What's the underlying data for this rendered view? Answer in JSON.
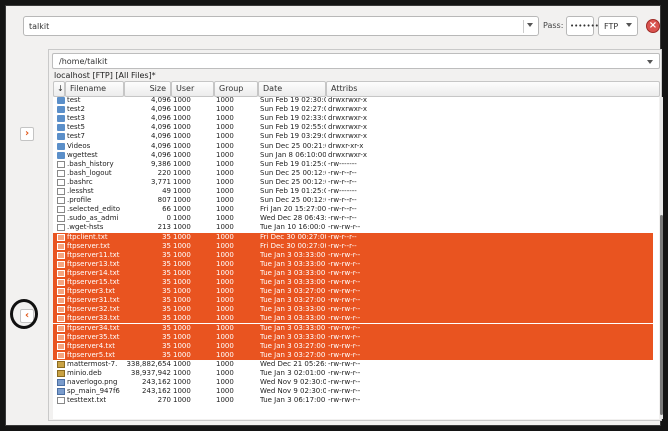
{
  "toolbar": {
    "host_value": "talkit",
    "pass_label": "Pass:",
    "pass_value": "••••••••",
    "protocol_value": "FTP"
  },
  "panel": {
    "path_value": "/home/talkit",
    "location_label": "localhost [FTP] [All Files]*"
  },
  "columns": [
    "Filename",
    "Size",
    "User",
    "Group",
    "Date",
    "Attribs"
  ],
  "files": [
    {
      "name": "test",
      "size": "4,096",
      "user": "1000",
      "group": "1000",
      "date": "Sun Feb 19 02:30:0",
      "attr": "drwxrwxr-x",
      "icon": "folder",
      "sel": false
    },
    {
      "name": "test2",
      "size": "4,096",
      "user": "1000",
      "group": "1000",
      "date": "Sun Feb 19 02:27:0",
      "attr": "drwxrwxr-x",
      "icon": "folder",
      "sel": false
    },
    {
      "name": "test3",
      "size": "4,096",
      "user": "1000",
      "group": "1000",
      "date": "Sun Feb 19 02:33:0",
      "attr": "drwxrwxr-x",
      "icon": "folder",
      "sel": false
    },
    {
      "name": "test5",
      "size": "4,096",
      "user": "1000",
      "group": "1000",
      "date": "Sun Feb 19 02:55:0",
      "attr": "drwxrwxr-x",
      "icon": "folder",
      "sel": false
    },
    {
      "name": "test7",
      "size": "4,096",
      "user": "1000",
      "group": "1000",
      "date": "Sun Feb 19 03:29:0",
      "attr": "drwxrwxr-x",
      "icon": "folder",
      "sel": false
    },
    {
      "name": "Videos",
      "size": "4,096",
      "user": "1000",
      "group": "1000",
      "date": "Sun Dec 25 00:21:0",
      "attr": "drwxr-xr-x",
      "icon": "folder",
      "sel": false
    },
    {
      "name": "wgettest",
      "size": "4,096",
      "user": "1000",
      "group": "1000",
      "date": "Sun Jan 8 06:10:00",
      "attr": "drwxrwxr-x",
      "icon": "folder",
      "sel": false
    },
    {
      "name": ".bash_history",
      "size": "9,386",
      "user": "1000",
      "group": "1000",
      "date": "Sun Feb 19 01:25:0",
      "attr": "-rw-------",
      "icon": "file",
      "sel": false
    },
    {
      "name": ".bash_logout",
      "size": "220",
      "user": "1000",
      "group": "1000",
      "date": "Sun Dec 25 00:12:0",
      "attr": "-rw-r--r--",
      "icon": "file",
      "sel": false
    },
    {
      "name": ".bashrc",
      "size": "3,771",
      "user": "1000",
      "group": "1000",
      "date": "Sun Dec 25 00:12:0",
      "attr": "-rw-r--r--",
      "icon": "file",
      "sel": false
    },
    {
      "name": ".lesshst",
      "size": "49",
      "user": "1000",
      "group": "1000",
      "date": "Sun Feb 19 01:25:0",
      "attr": "-rw-------",
      "icon": "file",
      "sel": false
    },
    {
      "name": ".profile",
      "size": "807",
      "user": "1000",
      "group": "1000",
      "date": "Sun Dec 25 00:12:0",
      "attr": "-rw-r--r--",
      "icon": "file",
      "sel": false
    },
    {
      "name": ".selected_edito",
      "size": "66",
      "user": "1000",
      "group": "1000",
      "date": "Fri Jan 20 15:27:00",
      "attr": "-rw-r--r--",
      "icon": "file",
      "sel": false
    },
    {
      "name": ".sudo_as_admi",
      "size": "0",
      "user": "1000",
      "group": "1000",
      "date": "Wed Dec 28 06:43:",
      "attr": "-rw-r--r--",
      "icon": "file",
      "sel": false
    },
    {
      "name": ".wget-hsts",
      "size": "213",
      "user": "1000",
      "group": "1000",
      "date": "Tue Jan 10 16:00:0",
      "attr": "-rw-rw-r--",
      "icon": "file",
      "sel": false
    },
    {
      "name": "ftpclient.txt",
      "size": "35",
      "user": "1000",
      "group": "1000",
      "date": "Fri Dec 30 00:27:00",
      "attr": "-rw-r--r--",
      "icon": "file",
      "sel": true
    },
    {
      "name": "ftpserver.txt",
      "size": "35",
      "user": "1000",
      "group": "1000",
      "date": "Fri Dec 30 00:27:00",
      "attr": "-rw-r--r--",
      "icon": "file",
      "sel": true
    },
    {
      "name": "ftpserver11.txt",
      "size": "35",
      "user": "1000",
      "group": "1000",
      "date": "Tue Jan 3 03:33:00",
      "attr": "-rw-rw-r--",
      "icon": "file",
      "sel": true
    },
    {
      "name": "ftpserver13.txt",
      "size": "35",
      "user": "1000",
      "group": "1000",
      "date": "Tue Jan 3 03:33:00",
      "attr": "-rw-rw-r--",
      "icon": "file",
      "sel": true
    },
    {
      "name": "ftpserver14.txt",
      "size": "35",
      "user": "1000",
      "group": "1000",
      "date": "Tue Jan 3 03:33:00",
      "attr": "-rw-rw-r--",
      "icon": "file",
      "sel": true
    },
    {
      "name": "ftpserver15.txt",
      "size": "35",
      "user": "1000",
      "group": "1000",
      "date": "Tue Jan 3 03:33:00",
      "attr": "-rw-rw-r--",
      "icon": "file",
      "sel": true
    },
    {
      "name": "ftpserver3.txt",
      "size": "35",
      "user": "1000",
      "group": "1000",
      "date": "Tue Jan 3 03:27:00",
      "attr": "-rw-rw-r--",
      "icon": "file",
      "sel": true
    },
    {
      "name": "ftpserver31.txt",
      "size": "35",
      "user": "1000",
      "group": "1000",
      "date": "Tue Jan 3 03:27:00",
      "attr": "-rw-rw-r--",
      "icon": "file",
      "sel": true
    },
    {
      "name": "ftpserver32.txt",
      "size": "35",
      "user": "1000",
      "group": "1000",
      "date": "Tue Jan 3 03:33:00",
      "attr": "-rw-rw-r--",
      "icon": "file",
      "sel": true
    },
    {
      "name": "ftpserver33.txt",
      "size": "35",
      "user": "1000",
      "group": "1000",
      "date": "Tue Jan 3 03:33:00",
      "attr": "-rw-rw-r--",
      "icon": "file",
      "sel": true
    },
    {
      "name": "ftpserver34.txt",
      "size": "35",
      "user": "1000",
      "group": "1000",
      "date": "Tue Jan 3 03:33:00",
      "attr": "-rw-rw-r--",
      "icon": "file",
      "sel": true
    },
    {
      "name": "ftpserver35.txt",
      "size": "35",
      "user": "1000",
      "group": "1000",
      "date": "Tue Jan 3 03:33:00",
      "attr": "-rw-rw-r--",
      "icon": "file",
      "sel": true
    },
    {
      "name": "ftpserver4.txt",
      "size": "35",
      "user": "1000",
      "group": "1000",
      "date": "Tue Jan 3 03:27:00",
      "attr": "-rw-rw-r--",
      "icon": "file",
      "sel": true
    },
    {
      "name": "ftpserver5.txt",
      "size": "35",
      "user": "1000",
      "group": "1000",
      "date": "Tue Jan 3 03:27:00",
      "attr": "-rw-rw-r--",
      "icon": "file",
      "sel": true
    },
    {
      "name": "mattermost-7.",
      "size": "338,882,654",
      "user": "1000",
      "group": "1000",
      "date": "Wed Dec 21 05:26:",
      "attr": "-rw-rw-r--",
      "icon": "pkg",
      "sel": false
    },
    {
      "name": "minio.deb",
      "size": "38,937,942",
      "user": "1000",
      "group": "1000",
      "date": "Tue Jan 3 02:01:00",
      "attr": "-rw-rw-r--",
      "icon": "pkg",
      "sel": false
    },
    {
      "name": "naverlogo.png",
      "size": "243,162",
      "user": "1000",
      "group": "1000",
      "date": "Wed Nov 9 02:30:00",
      "attr": "-rw-rw-r--",
      "icon": "img",
      "sel": false
    },
    {
      "name": "sp_main_947f6",
      "size": "243,162",
      "user": "1000",
      "group": "1000",
      "date": "Wed Nov 9 02:30:00",
      "attr": "-rw-rw-r--",
      "icon": "img",
      "sel": false
    },
    {
      "name": "testtext.txt",
      "size": "270",
      "user": "1000",
      "group": "1000",
      "date": "Tue Jan 3 06:17:00",
      "attr": "-rw-rw-r--",
      "icon": "file",
      "sel": false
    }
  ],
  "icons": {
    "close": "close-icon",
    "side_right": "chevron-right-icon",
    "side_left": "chevron-left-icon"
  },
  "colors": {
    "selection": "#e95420",
    "close": "#d9534f"
  }
}
